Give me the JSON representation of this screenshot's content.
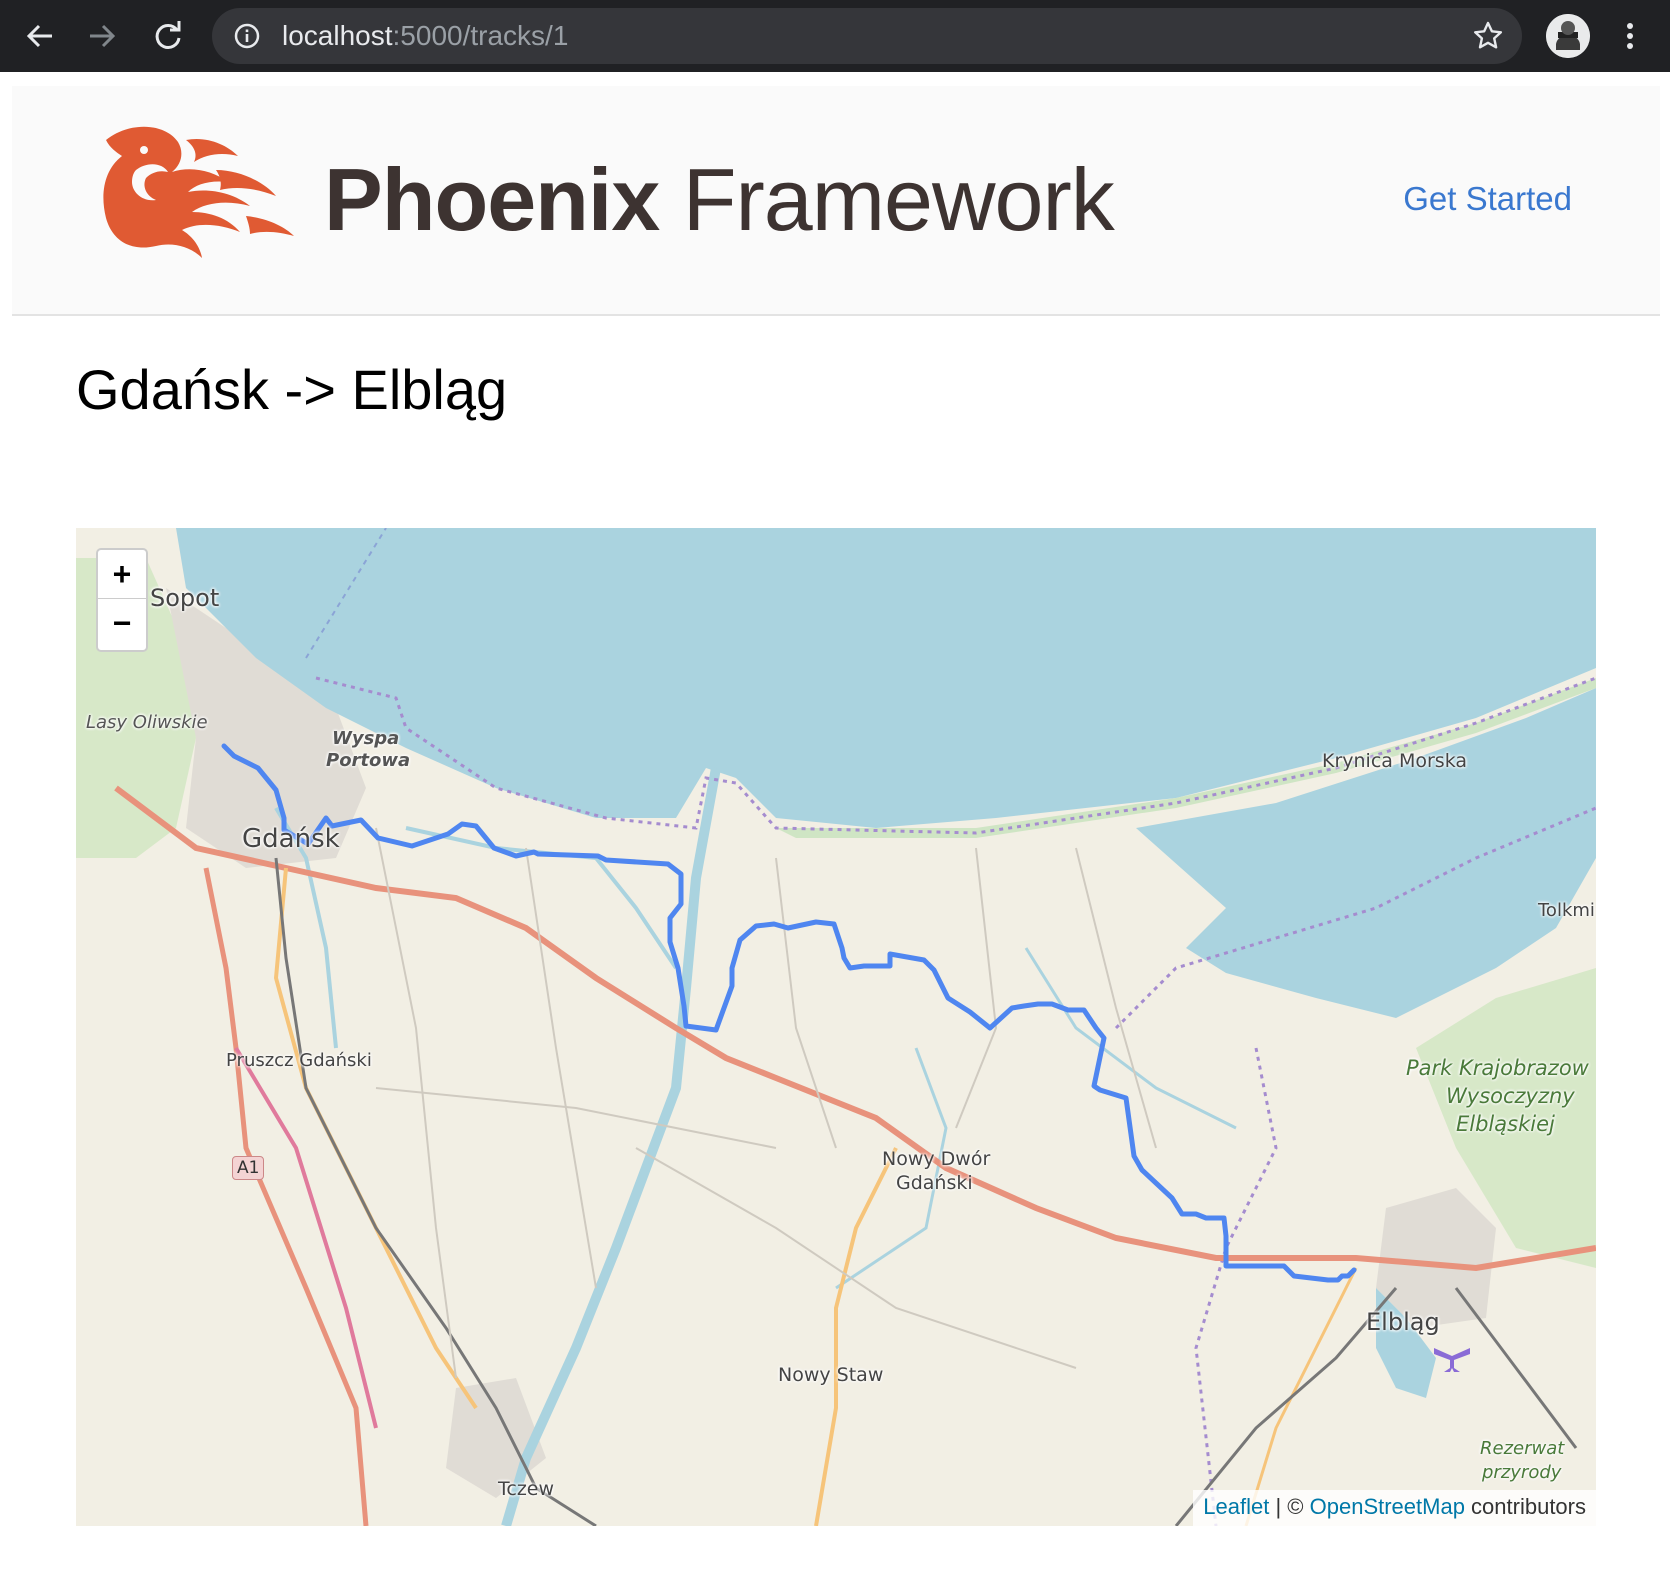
{
  "browser": {
    "url_host": "localhost",
    "url_path": ":5000/tracks/1",
    "icons": {
      "back": "arrow-left-icon",
      "forward": "arrow-right-icon",
      "reload": "reload-icon",
      "info": "info-icon",
      "bookmark": "star-icon",
      "menu": "kebab-menu-icon"
    }
  },
  "header": {
    "brand_bold": "Phoenix",
    "brand_light": " Framework",
    "get_started": "Get Started",
    "logo_icon": "phoenix-bird-logo",
    "brand_color": "#e05a33"
  },
  "page": {
    "title": "Gdańsk -> Elbląg"
  },
  "map": {
    "zoom_in": "+",
    "zoom_out": "−",
    "attribution": {
      "leaflet": "Leaflet",
      "separator": " | © ",
      "osm": "OpenStreetMap",
      "contributors": " contributors"
    },
    "route_color": "#4f86f0",
    "labels": {
      "sopot": "Sopot",
      "lasy": "Lasy Oliwskie",
      "wyspa": "Wyspa",
      "portowa": "Portowa",
      "gdansk": "Gdańsk",
      "krynica": "Krynica Morska",
      "tolkmi": "Tolkmi",
      "pruszcz": "Pruszcz Gdański",
      "a1": "A1",
      "nowy_dwor_1": "Nowy Dwór",
      "nowy_dwor_2": "Gdański",
      "park_1": "Park Krajobrazow",
      "park_2": "Wysoczyzny",
      "park_3": "Elbląskiej",
      "elblag": "Elbląg",
      "nowy_staw": "Nowy Staw",
      "tczew": "Tczew",
      "rezerwat_1": "Rezerwat",
      "rezerwat_2": "przyrody"
    }
  }
}
